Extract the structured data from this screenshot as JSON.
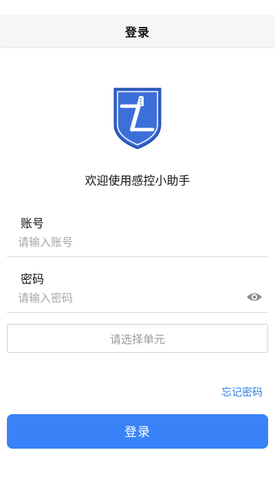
{
  "header": {
    "title": "登录"
  },
  "welcome_text": "欢迎使用感控小助手",
  "account": {
    "label": "账号",
    "placeholder": "请输入账号",
    "value": ""
  },
  "password": {
    "label": "密码",
    "placeholder": "请输入密码",
    "value": "",
    "toggle_icon": "eye-icon"
  },
  "unit_select": {
    "placeholder": "请选择单元"
  },
  "forgot_password": "忘记密码",
  "login_button": "登录",
  "colors": {
    "primary": "#3a82f7",
    "link": "#2f7be0",
    "logo_blue": "#3d6fd9",
    "logo_border": "#2756b5",
    "placeholder": "#a6a6a6",
    "divider": "#d8d8d8"
  }
}
